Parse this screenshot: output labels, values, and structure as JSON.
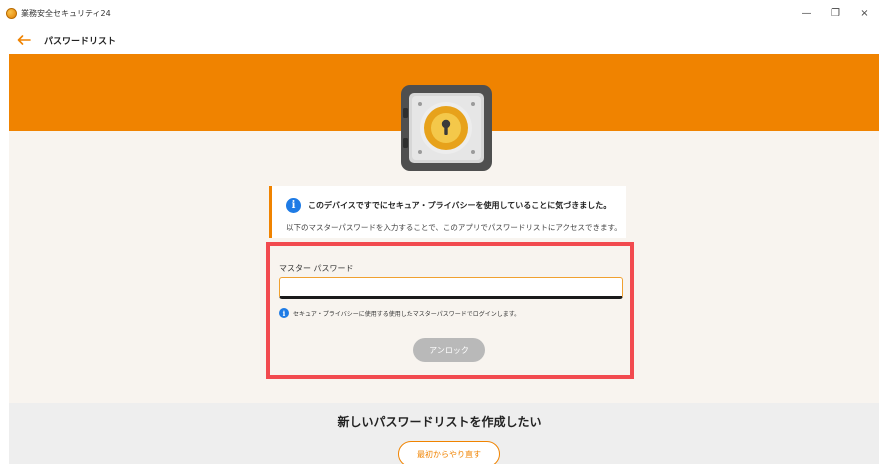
{
  "window": {
    "title": "業務安全セキュリティ24",
    "controls": {
      "minimize": "—",
      "restore": "❐",
      "close": "×"
    }
  },
  "header": {
    "title": "パスワードリスト",
    "back_icon": "arrow-left-icon"
  },
  "colors": {
    "accent": "#f08300",
    "highlight_border": "#f24a4f",
    "info_blue": "#1e7be5",
    "button_disabled": "#b9b9b9"
  },
  "info": {
    "icon": "i",
    "title": "このデバイスですでにセキュア・プライバシーを使用していることに気づきました。",
    "description": "以下のマスターパスワードを入力することで、このアプリでパスワードリストにアクセスできます。"
  },
  "login": {
    "label": "マスター パスワード",
    "value": "",
    "hint_icon": "i",
    "hint": "セキュア・プライバシーに使用する使用したマスターパスワードでログインします。",
    "unlock_label": "アンロック"
  },
  "create": {
    "heading": "新しいパスワードリストを作成したい",
    "restart_label": "最初からやり直す"
  }
}
